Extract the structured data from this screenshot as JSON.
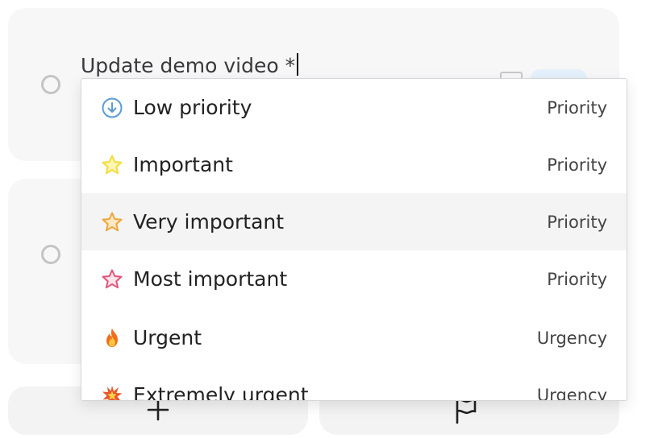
{
  "task": {
    "title_value": "Update demo video *"
  },
  "dropdown": {
    "options": [
      {
        "label": "Low priority",
        "category": "Priority",
        "icon": "arrow-down-circle-icon",
        "color": "#5b9bd5"
      },
      {
        "label": "Important",
        "category": "Priority",
        "icon": "star-icon",
        "color": "#f2dc3b"
      },
      {
        "label": "Very important",
        "category": "Priority",
        "icon": "star-icon",
        "color": "#f0a53a",
        "highlighted": true
      },
      {
        "label": "Most important",
        "category": "Priority",
        "icon": "star-icon",
        "color": "#e2557a"
      },
      {
        "label": "Urgent",
        "category": "Urgency",
        "icon": "fire-icon"
      },
      {
        "label": "Extremely urgent",
        "category": "Urgency",
        "icon": "explosion-icon"
      }
    ]
  },
  "bottom_bar": {
    "add_icon": "plus-icon",
    "flag_icon": "flag-icon"
  }
}
